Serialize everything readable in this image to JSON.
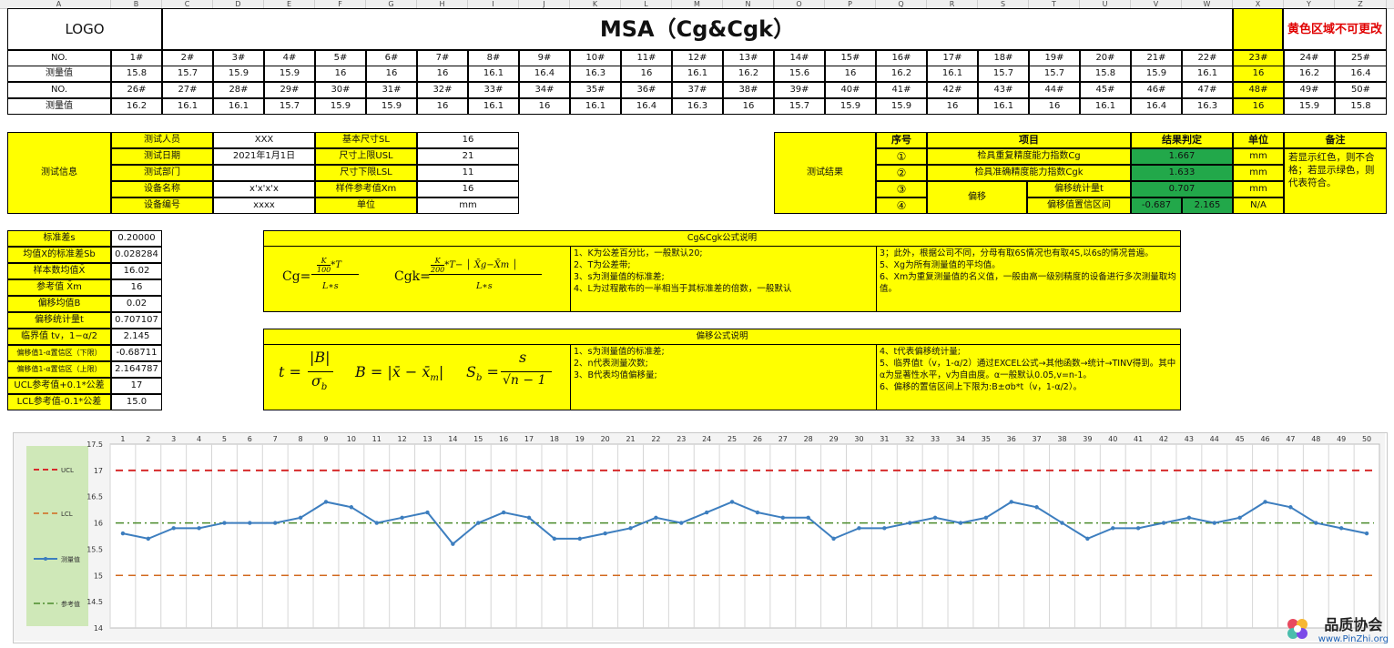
{
  "colheaders": [
    "A",
    "B",
    "C",
    "D",
    "E",
    "F",
    "G",
    "H",
    "I",
    "J",
    "K",
    "L",
    "M",
    "N",
    "O",
    "P",
    "Q",
    "R",
    "S",
    "T",
    "U",
    "V",
    "W",
    "X",
    "Y",
    "Z"
  ],
  "header": {
    "logo": "LOGO",
    "title": "MSA（Cg&Cgk）",
    "note": "黄色区域不可更改"
  },
  "measure": {
    "no_label": "NO.",
    "val_label": "测量值",
    "row1_nos": [
      "1#",
      "2#",
      "3#",
      "4#",
      "5#",
      "6#",
      "7#",
      "8#",
      "9#",
      "10#",
      "11#",
      "12#",
      "13#",
      "14#",
      "15#",
      "16#",
      "17#",
      "18#",
      "19#",
      "20#",
      "21#",
      "22#",
      "23#",
      "24#",
      "25#"
    ],
    "row1_vals": [
      "15.8",
      "15.7",
      "15.9",
      "15.9",
      "16",
      "16",
      "16",
      "16.1",
      "16.4",
      "16.3",
      "16",
      "16.1",
      "16.2",
      "15.6",
      "16",
      "16.2",
      "16.1",
      "15.7",
      "15.7",
      "15.8",
      "15.9",
      "16.1",
      "16",
      "16.2",
      "16.4"
    ],
    "row2_nos": [
      "26#",
      "27#",
      "28#",
      "29#",
      "30#",
      "31#",
      "32#",
      "33#",
      "34#",
      "35#",
      "36#",
      "37#",
      "38#",
      "39#",
      "40#",
      "41#",
      "42#",
      "43#",
      "44#",
      "45#",
      "46#",
      "47#",
      "48#",
      "49#",
      "50#"
    ],
    "row2_vals": [
      "16.2",
      "16.1",
      "16.1",
      "15.7",
      "15.9",
      "15.9",
      "16",
      "16.1",
      "16",
      "16.1",
      "16.4",
      "16.3",
      "16",
      "15.7",
      "15.9",
      "15.9",
      "16",
      "16.1",
      "16",
      "16.1",
      "16.4",
      "16.3",
      "16",
      "15.9",
      "15.8"
    ]
  },
  "info": {
    "title": "测试信息",
    "labels": [
      "测试人员",
      "测试日期",
      "测试部门",
      "设备名称",
      "设备编号"
    ],
    "values": [
      "XXX",
      "2021年1月1日",
      "",
      "x'x'x'x",
      "xxxx"
    ],
    "labels2": [
      "基本尺寸SL",
      "尺寸上限USL",
      "尺寸下限LSL",
      "样件参考值Xm",
      "单位"
    ],
    "values2": [
      "16",
      "21",
      "11",
      "16",
      "mm"
    ]
  },
  "result": {
    "title": "测试结果",
    "headers": [
      "序号",
      "项目",
      "结果判定",
      "单位",
      "备注"
    ],
    "nums": [
      "①",
      "②",
      "③",
      "④"
    ],
    "items": [
      "检具重复精度能力指数Cg",
      "检具准确精度能力指数Cgk"
    ],
    "bias_label": "偏移",
    "bias_items": [
      "偏移统计量t",
      "偏移值置信区间"
    ],
    "values": [
      "1.667",
      "1.633",
      "0.707"
    ],
    "ci_low": "-0.687",
    "ci_high": "2.165",
    "units": [
      "mm",
      "mm",
      "mm",
      "N/A"
    ],
    "remark": "若显示红色，则不合格；若显示绿色，则代表符合。"
  },
  "stats": {
    "labels": [
      "标准差s",
      "均值X的标准差Sb",
      "样本数均值X̄",
      "参考值 X̄m",
      "偏移均值B",
      "偏移统计量t",
      "临界值  tv，1−α/2",
      "偏移值1-α置信区（下限）",
      "偏移值1-α置信区（上限）",
      "UCL参考值+0.1*公差",
      "LCL参考值-0.1*公差"
    ],
    "values": [
      "0.20000",
      "0.028284",
      "16.02",
      "16",
      "0.02",
      "0.707107",
      "2.145",
      "-0.68711",
      "2.164787",
      "17",
      "15.0"
    ]
  },
  "formula1": {
    "title": "Cg&Cgk公式说明",
    "cg_label": "Cg=",
    "cgk_label": "Cgk=",
    "lines_a": [
      "1、K为公差百分比，一般默认20;",
      "2、T为公差带;",
      "3、s为测量值的标准差;",
      "4、L为过程散布的一半相当于其标准差的倍数，一般默认"
    ],
    "lines_b": [
      "3；此外，根据公司不同，分母有取6S情况也有取4S,以6s的情况普遍。",
      "5、Xg为所有测量值的平均值。",
      "6、Xm为重复测量值的名义值，一般由高一级别精度的设备进行多次测量取均值。"
    ]
  },
  "formula2": {
    "title": "偏移公式说明",
    "lines_a": [
      "1、s为测量值的标准差;",
      "2、n代表测量次数;",
      "3、B代表均值偏移量;"
    ],
    "lines_b": [
      "4、t代表偏移统计量;",
      "5、临界值t（v，1-α/2）通过EXCEL公式→其他函数→统计→TINV得到。其中α为显著性水平，v为自由度。α一般默认0.05,v=n-1。",
      "6、偏移的置信区间上下限为:B±σb*t（v，1-α/2）。"
    ]
  },
  "chart_data": {
    "type": "line",
    "x": [
      1,
      2,
      3,
      4,
      5,
      6,
      7,
      8,
      9,
      10,
      11,
      12,
      13,
      14,
      15,
      16,
      17,
      18,
      19,
      20,
      21,
      22,
      23,
      24,
      25,
      26,
      27,
      28,
      29,
      30,
      31,
      32,
      33,
      34,
      35,
      36,
      37,
      38,
      39,
      40,
      41,
      42,
      43,
      44,
      45,
      46,
      47,
      48,
      49,
      50
    ],
    "series": [
      {
        "name": "测量值",
        "color": "#3d7ebf",
        "values": [
          15.8,
          15.7,
          15.9,
          15.9,
          16,
          16,
          16,
          16.1,
          16.4,
          16.3,
          16,
          16.1,
          16.2,
          15.6,
          16,
          16.2,
          16.1,
          15.7,
          15.7,
          15.8,
          15.9,
          16.1,
          16,
          16.2,
          16.4,
          16.2,
          16.1,
          16.1,
          15.7,
          15.9,
          15.9,
          16,
          16.1,
          16,
          16.1,
          16.4,
          16.3,
          16,
          15.7,
          15.9,
          15.9,
          16,
          16.1,
          16,
          16.1,
          16.4,
          16.3,
          16,
          15.9,
          15.8
        ]
      },
      {
        "name": "UCL",
        "color": "#d62b2b",
        "values": [
          17
        ]
      },
      {
        "name": "LCL",
        "color": "#d2691e",
        "values": [
          15
        ]
      },
      {
        "name": "参考值",
        "color": "#4a8a2a",
        "values": [
          16
        ]
      }
    ],
    "ylim": [
      14,
      17.5
    ],
    "yticks": [
      "14",
      "14.5",
      "15",
      "15.5",
      "16",
      "16.5",
      "17",
      "17.5"
    ],
    "grid": true,
    "legend": "left"
  },
  "watermark": {
    "name": "品质协会",
    "url": "www.PinZhi.org"
  }
}
